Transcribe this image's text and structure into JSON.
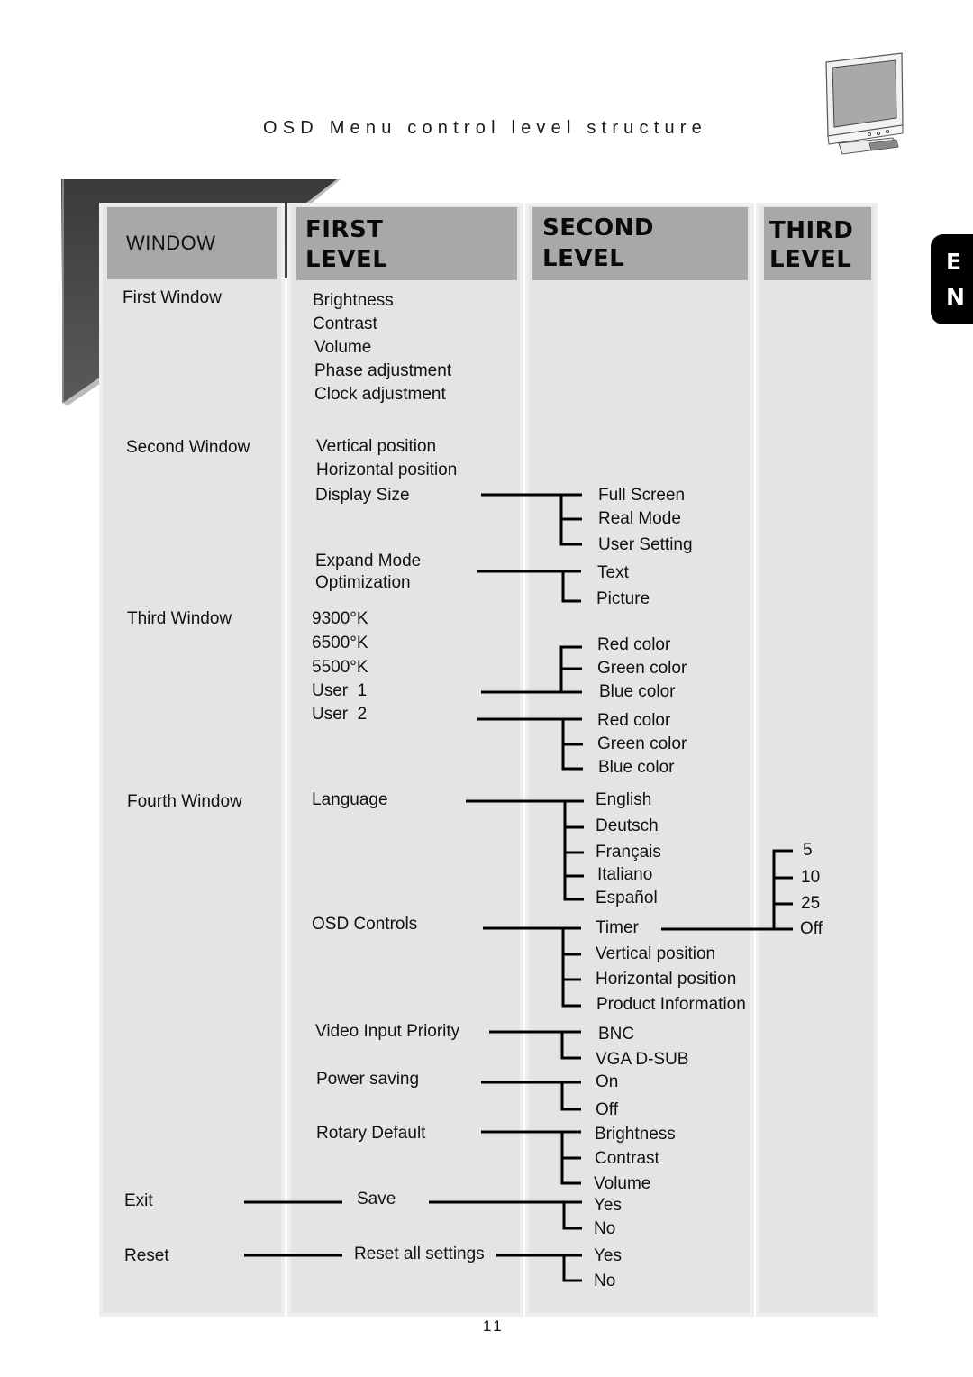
{
  "title": "OSD Menu control level structure",
  "language_tab": [
    "E",
    "N"
  ],
  "page_number": "11",
  "headers": {
    "window": "WINDOW",
    "first_level": [
      "FIRST",
      "LEVEL"
    ],
    "second_level": [
      "SECOND",
      "LEVEL"
    ],
    "third_level": [
      "THIRD",
      "LEVEL"
    ]
  },
  "windows": [
    "First Window",
    "Second Window",
    "Third Window",
    "Fourth Window",
    "Exit",
    "Reset"
  ],
  "first_level": {
    "first_window": [
      "Brightness",
      "Contrast",
      "Volume",
      "Phase adjustment",
      "Clock adjustment"
    ],
    "second_window": [
      "Vertical position",
      "Horizontal position",
      "Display Size",
      "Expand Mode",
      "Optimization"
    ],
    "third_window": [
      "9300°K",
      "6500°K",
      "5500°K",
      "User  1",
      "User  2"
    ],
    "fourth_window": [
      "Language",
      "OSD Controls",
      "Video Input Priority",
      "Power saving",
      "Rotary Default"
    ],
    "exit": "Save",
    "reset": "Reset all settings"
  },
  "second_level": {
    "display_size": [
      "Full Screen",
      "Real Mode",
      "User Setting"
    ],
    "expand_mode": [
      "Text",
      "Picture"
    ],
    "user1": [
      "Red color",
      "Green color",
      "Blue color"
    ],
    "user2": [
      "Red color",
      "Green color",
      "Blue color"
    ],
    "language": [
      "English",
      "Deutsch",
      "Français",
      "Italiano",
      "Español"
    ],
    "osd_controls": [
      "Timer",
      "Vertical position",
      "Horizontal position",
      "Product Information"
    ],
    "video_input_priority": [
      "BNC",
      "VGA D-SUB"
    ],
    "power_saving": [
      "On",
      "Off"
    ],
    "rotary_default": [
      "Brightness",
      "Contrast",
      "Volume"
    ],
    "save": [
      "Yes",
      "No"
    ],
    "reset_all": [
      "Yes",
      "No"
    ]
  },
  "third_level": {
    "timer": [
      "5",
      "10",
      "25",
      "Off"
    ]
  }
}
